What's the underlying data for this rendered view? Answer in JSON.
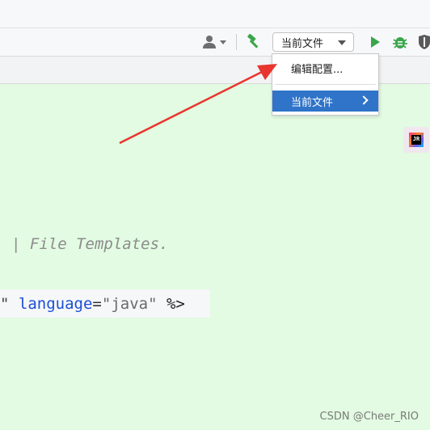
{
  "toolbar": {
    "user_icon": "user-icon",
    "build_icon": "hammer-icon",
    "config_selected": "当前文件",
    "run_icon": "run-icon",
    "debug_icon": "bug-icon",
    "coverage_icon": "shield-icon"
  },
  "config_menu": {
    "edit_item": "编辑配置...",
    "current_file_item": "当前文件"
  },
  "editor": {
    "comment_text": "| File Templates.",
    "jsp_quote": "\"",
    "jsp_attr": "language",
    "jsp_eq": "=",
    "jsp_value": "\"java\"",
    "jsp_close": "%>"
  },
  "watermark": "CSDN @Cheer_RIO",
  "colors": {
    "editor_bg": "#e2fbe2",
    "selection": "#2f74c8",
    "arrow": "#e8352e",
    "run_green": "#3aa64a"
  }
}
